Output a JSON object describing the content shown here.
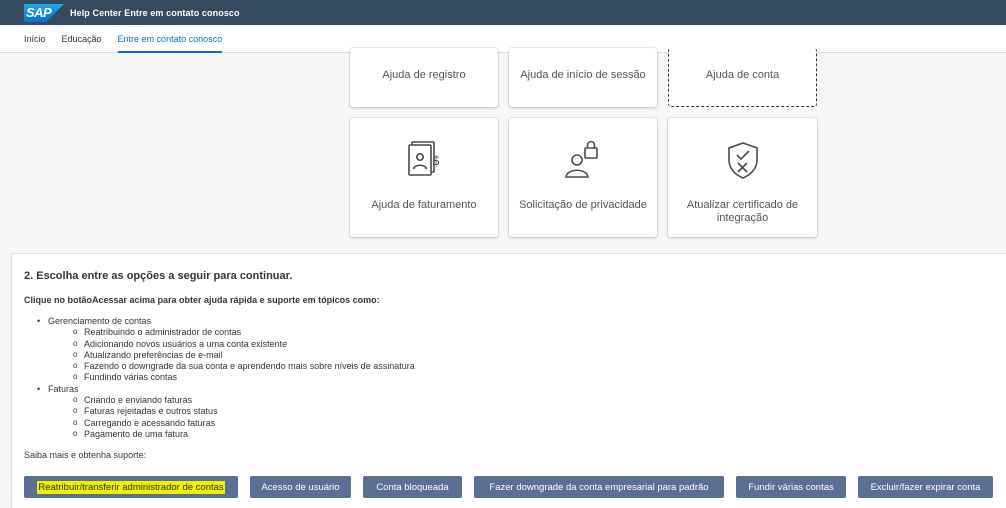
{
  "shellbar": {
    "logo": "SAP",
    "title": "Help Center Entre em contato conosco"
  },
  "subnav": {
    "tabs": [
      {
        "label": "Início"
      },
      {
        "label": "Educação"
      },
      {
        "label": "Entre em contato conosco",
        "active": true
      }
    ]
  },
  "tiles_top": [
    {
      "label": "Ajuda de registro"
    },
    {
      "label": "Ajuda de início de sessão"
    },
    {
      "label": "Ajuda de conta"
    }
  ],
  "tiles_bottom": [
    {
      "label": "Ajuda de faturamento",
      "icon": "invoice-dollar-icon"
    },
    {
      "label": "Solicitação de privacidade",
      "icon": "user-lock-icon"
    },
    {
      "label": "Atualizar certificado de integração",
      "icon": "shield-x-icon"
    }
  ],
  "section": {
    "heading": "2. Escolha entre as opções a seguir para continuar.",
    "intro": "Clique no botãoAcessar acima para obter ajuda rápida e suporte em tópicos como:",
    "groups": [
      {
        "label": "Gerenciamento de contas",
        "items": [
          "Reatribuindo o administrador de contas",
          "Adicionando novos usuários a uma conta existente",
          "Atualizando preferências de e-mail",
          "Fazendo o downgrade da sua conta e aprendendo mais sobre níveis de assinatura",
          "Fundindo várias contas"
        ]
      },
      {
        "label": "Faturas",
        "items": [
          "Criando e enviando faturas",
          "Faturas rejeitadas e outros status",
          "Carregando e acessando faturas",
          "Pagamento de uma fatura"
        ]
      }
    ],
    "more": "Saiba mais e obtenha suporte:"
  },
  "buttons": [
    "Reatribuir/transferir administrador de contas",
    "Acesso de usuário",
    "Conta bloqueada",
    "Fazer downgrade da conta empresarial para padrão",
    "Fundir várias contas",
    "Excluir/fazer expirar conta"
  ],
  "colors": {
    "shellbar": "#354a5f",
    "accent": "#0a6ed1",
    "button": "#5b6f96",
    "highlight": "#f0f000"
  }
}
